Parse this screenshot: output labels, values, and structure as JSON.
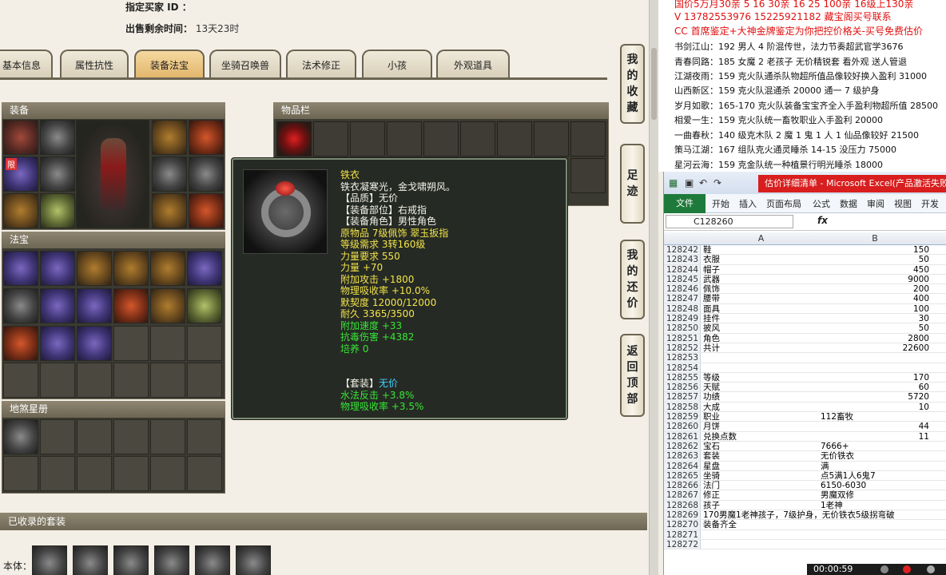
{
  "seller": {
    "buyer_label": "指定买家 ID ：",
    "time_label": "出售剩余时间：",
    "time_value": "13天23时"
  },
  "tabs": [
    {
      "label": "基本信息"
    },
    {
      "label": "属性抗性"
    },
    {
      "label": "装备法宝",
      "active": true
    },
    {
      "label": "坐骑召唤兽"
    },
    {
      "label": "法术修正"
    },
    {
      "label": "小孩"
    },
    {
      "label": "外观道具"
    }
  ],
  "sections": {
    "equip": "装备",
    "fabao": "法宝",
    "bag": "物品栏",
    "soul": "地煞星册",
    "collected": "已收录的套装",
    "collected_row": "本体："
  },
  "limit_badge": "限",
  "side_buttons": [
    {
      "label": [
        "我",
        "的",
        "收",
        "藏"
      ]
    },
    {
      "label": [
        "足",
        "迹"
      ]
    },
    {
      "label": [
        "我",
        "的",
        "还",
        "价"
      ]
    },
    {
      "label": [
        "返",
        "回",
        "顶",
        "部"
      ]
    }
  ],
  "tooltip": {
    "name": "铁衣",
    "desc": "铁衣凝寒光，金戈啸朔风。",
    "lines": [
      {
        "text": "【品质】无价",
        "color": "white"
      },
      {
        "text": "【装备部位】右戒指",
        "color": "white"
      },
      {
        "text": "【装备角色】男性角色",
        "color": "white"
      },
      {
        "text": "原物品 7级佩饰 翠玉扳指",
        "color": "yellow"
      },
      {
        "text": "等级需求 3转160级",
        "color": "yellow"
      },
      {
        "text": "力量要求 550",
        "color": "yellow"
      },
      {
        "text": "力量 +70",
        "color": "yellow"
      },
      {
        "text": "附加攻击 +1800",
        "color": "yellow"
      },
      {
        "text": "物理吸收率 +10.0%",
        "color": "yellow"
      },
      {
        "text": "默契度 12000/12000",
        "color": "yellow"
      },
      {
        "text": "耐久 3365/3500",
        "color": "yellow"
      },
      {
        "text": "附加速度 +33",
        "color": "green"
      },
      {
        "text": "抗毒伤害 +4382",
        "color": "green"
      },
      {
        "text": "培养 0",
        "color": "green"
      }
    ],
    "set_label": "【套装】",
    "set_value": "无价",
    "set_lines": [
      "水法反击 +3.8%",
      "物理吸收率 +3.5%"
    ]
  },
  "doc": {
    "lines": [
      {
        "text": "国价5万月30亲   5 16 30亲   16 25 100亲   16级上130亲",
        "color": "red"
      },
      {
        "text": "V 13782553976    15225921182   藏宝阁买号联系",
        "color": "red"
      },
      {
        "text": "CC 首席鉴定+大神金牌鉴定为你把控价格关-买号免费估价",
        "color": "red"
      },
      {
        "text": "书剑江山：192 男人 4 阶混传世，法力节奏超武官学3676",
        "color": "black"
      },
      {
        "text": "青春同路：185 女魔 2 老孩子 无价精锐套 看外观 送人管退",
        "color": "black"
      },
      {
        "text": "江湖夜雨：159 克火队通杀队物超所值品像较好换入盈利 31000",
        "color": "black"
      },
      {
        "text": "山西新区：159 克火队混通杀 20000 通一 7 级护身",
        "color": "black"
      },
      {
        "text": "岁月如歌：165-170 克火队装备宝宝齐全入手盈利物超所值 28500",
        "color": "black"
      },
      {
        "text": "相爱一生：159 克火队统一畜牧职业入手盈利 20000",
        "color": "black"
      },
      {
        "text": "一曲春秋：140 级克木队 2 魔 1 鬼 1 人 1 仙品像较好 21500",
        "color": "black"
      },
      {
        "text": "策马江湖：167 组队克火通灵睡杀 14-15 没压力 75000",
        "color": "black"
      },
      {
        "text": "星河云海：159 克金队统一种植景行明光睡杀 18000",
        "color": "black"
      }
    ]
  },
  "excel": {
    "title": "估价详细清单 - Microsoft Excel(产品激活失败)",
    "ribbon": [
      "文件",
      "开始",
      "插入",
      "页面布局",
      "公式",
      "数据",
      "审阅",
      "视图",
      "开发工"
    ],
    "namebox": "C128260",
    "fx": "fx",
    "col_a": "A",
    "col_b": "B",
    "rows": [
      {
        "n": "128242",
        "a": "鞋",
        "b": "150",
        "num": true
      },
      {
        "n": "128243",
        "a": "衣服",
        "b": "50",
        "num": true
      },
      {
        "n": "128244",
        "a": "帽子",
        "b": "450",
        "num": true
      },
      {
        "n": "128245",
        "a": "武器",
        "b": "9000",
        "num": true
      },
      {
        "n": "128246",
        "a": "佩饰",
        "b": "200",
        "num": true
      },
      {
        "n": "128247",
        "a": "腰带",
        "b": "400",
        "num": true
      },
      {
        "n": "128248",
        "a": "面具",
        "b": "100",
        "num": true
      },
      {
        "n": "128249",
        "a": "挂件",
        "b": "30",
        "num": true
      },
      {
        "n": "128250",
        "a": "披风",
        "b": "50",
        "num": true
      },
      {
        "n": "128251",
        "a": "角色",
        "b": "2800",
        "num": true
      },
      {
        "n": "128252",
        "a": "共计",
        "b": "22600",
        "num": true
      },
      {
        "n": "128253",
        "a": "",
        "b": "",
        "num": true
      },
      {
        "n": "128254",
        "a": "",
        "b": "",
        "num": true
      },
      {
        "n": "128255",
        "a": "等级",
        "b": "170",
        "num": true
      },
      {
        "n": "128256",
        "a": "天赋",
        "b": "60",
        "num": true
      },
      {
        "n": "128257",
        "a": "功绩",
        "b": "5720",
        "num": true
      },
      {
        "n": "128258",
        "a": "大成",
        "b": "10",
        "num": true
      },
      {
        "n": "128259",
        "a": "职业",
        "b": "112畜牧",
        "num": false
      },
      {
        "n": "128260",
        "a": "月饼",
        "b": "44",
        "num": true
      },
      {
        "n": "128261",
        "a": "兑换点数",
        "b": "11",
        "num": true
      },
      {
        "n": "128262",
        "a": "宝石",
        "b": "7666+",
        "num": false
      },
      {
        "n": "128263",
        "a": "套装",
        "b": "无价铁衣",
        "num": false
      },
      {
        "n": "128264",
        "a": "星盘",
        "b": "满",
        "num": false
      },
      {
        "n": "128265",
        "a": "坐骑",
        "b": "点5满1人6鬼7",
        "num": false
      },
      {
        "n": "128266",
        "a": "法门",
        "b": "6150-6030",
        "num": false
      },
      {
        "n": "128267",
        "a": "修正",
        "b": "男魔双修",
        "num": false
      },
      {
        "n": "128268",
        "a": "孩子",
        "b": "1老神",
        "num": false
      },
      {
        "n": "128269",
        "a": "170男魔1老神孩子，7级护身，无价铁衣5级拐弯破",
        "b": "",
        "num": false
      },
      {
        "n": "128270",
        "a": "装备齐全",
        "b": "",
        "num": false
      },
      {
        "n": "128271",
        "a": "",
        "b": "",
        "num": false
      },
      {
        "n": "128272",
        "a": "",
        "b": "",
        "num": false
      }
    ]
  },
  "recorder": {
    "time": "00:00:59"
  }
}
